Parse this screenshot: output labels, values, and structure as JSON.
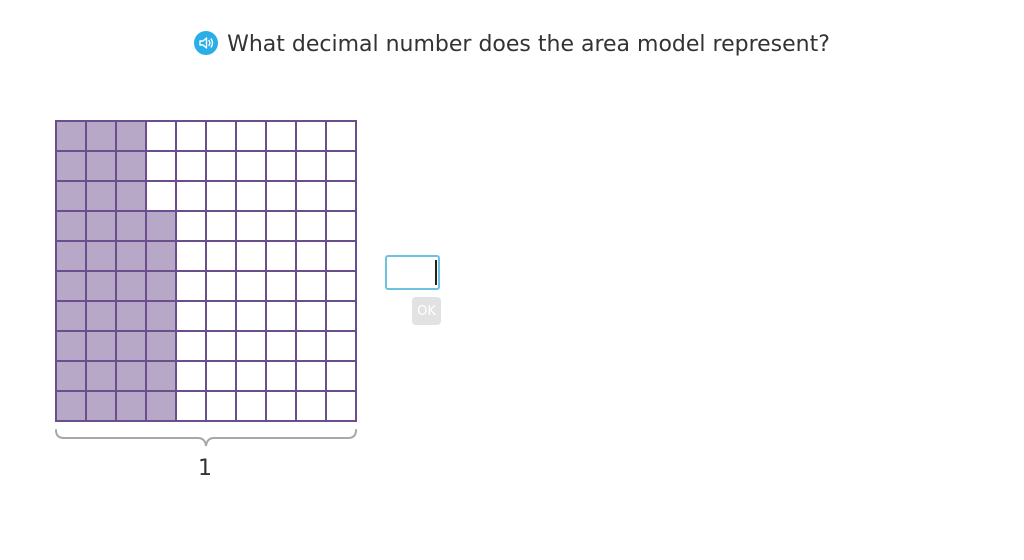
{
  "question": {
    "text": "What decimal number does the area model represent?",
    "audio_icon": "speaker-icon"
  },
  "area_model": {
    "rows": 10,
    "cols": 10,
    "shaded_columns_per_row": [
      3,
      3,
      3,
      4,
      4,
      4,
      4,
      4,
      4,
      4
    ],
    "shaded_count": 37,
    "shade_color": "#b7a8c8",
    "line_color": "#6b4f8c",
    "brace_label": "1"
  },
  "answer": {
    "value": "",
    "placeholder": ""
  },
  "ok_button": {
    "label": "OK"
  },
  "colors": {
    "accent": "#29aee8",
    "input_border": "#6cc3e0",
    "text": "#333333"
  }
}
